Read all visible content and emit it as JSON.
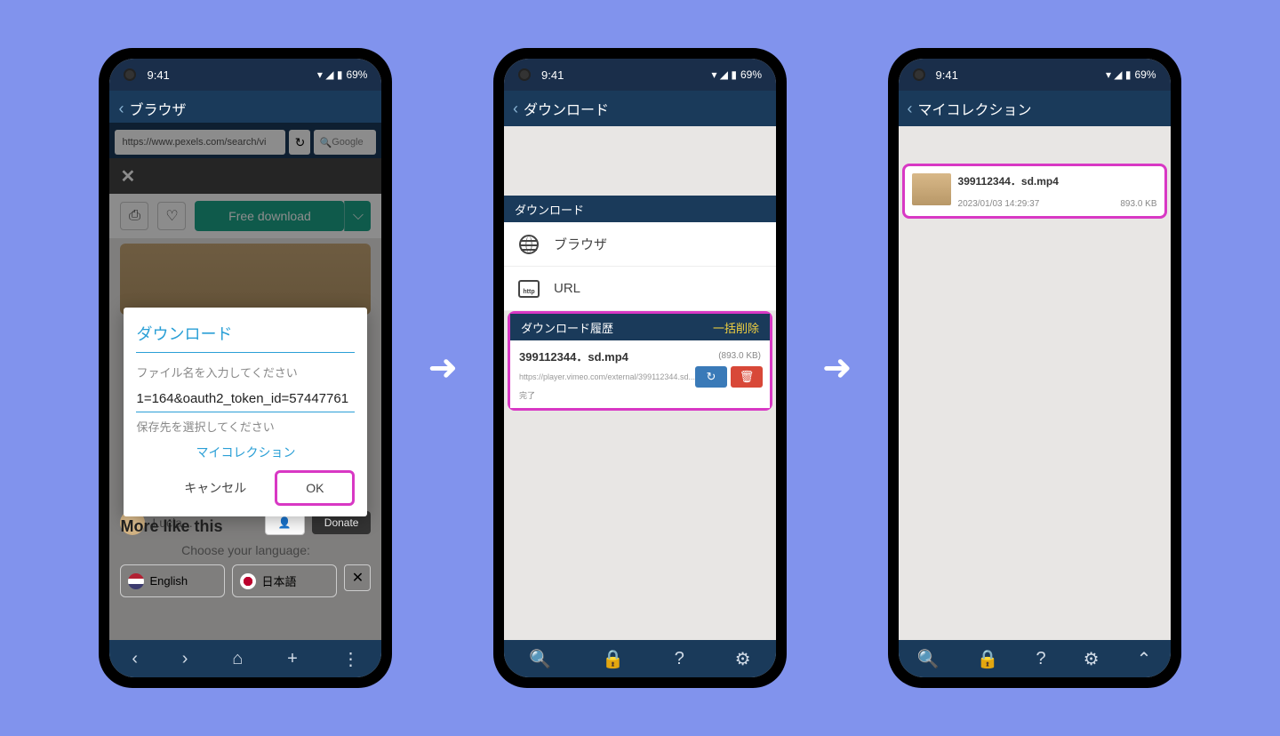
{
  "status": {
    "time": "9:41",
    "battery": "69%"
  },
  "s1": {
    "title": "ブラウザ",
    "url": "https://www.pexels.com/search/vi",
    "search": "Google",
    "free_download": "Free download",
    "dialog_title": "ダウンロード",
    "filename_label": "ファイル名を入力してください",
    "filename_value": "1=164&oauth2_token_id=57447761",
    "dest_label": "保存先を選択してください",
    "collection": "マイコレクション",
    "cancel": "キャンセル",
    "ok": "OK",
    "author": "Lucia...",
    "donate": "Donate",
    "more_like": "More like this",
    "choose_lang": "Choose your language:",
    "lang1": "English",
    "lang2": "日本語"
  },
  "s2": {
    "title": "ダウンロード",
    "sect_download": "ダウンロード",
    "browser": "ブラウザ",
    "url_label": "URL",
    "history": "ダウンロード履歴",
    "batch_delete": "一括削除",
    "filename": "399112344．sd.mp4",
    "size": "(893.0 KB)",
    "src_url": "https://player.vimeo.com/external/399112344.sd...",
    "done": "完了"
  },
  "s3": {
    "title": "マイコレクション",
    "filename": "399112344．sd.mp4",
    "date": "2023/01/03 14:29:37",
    "size": "893.0 KB"
  }
}
